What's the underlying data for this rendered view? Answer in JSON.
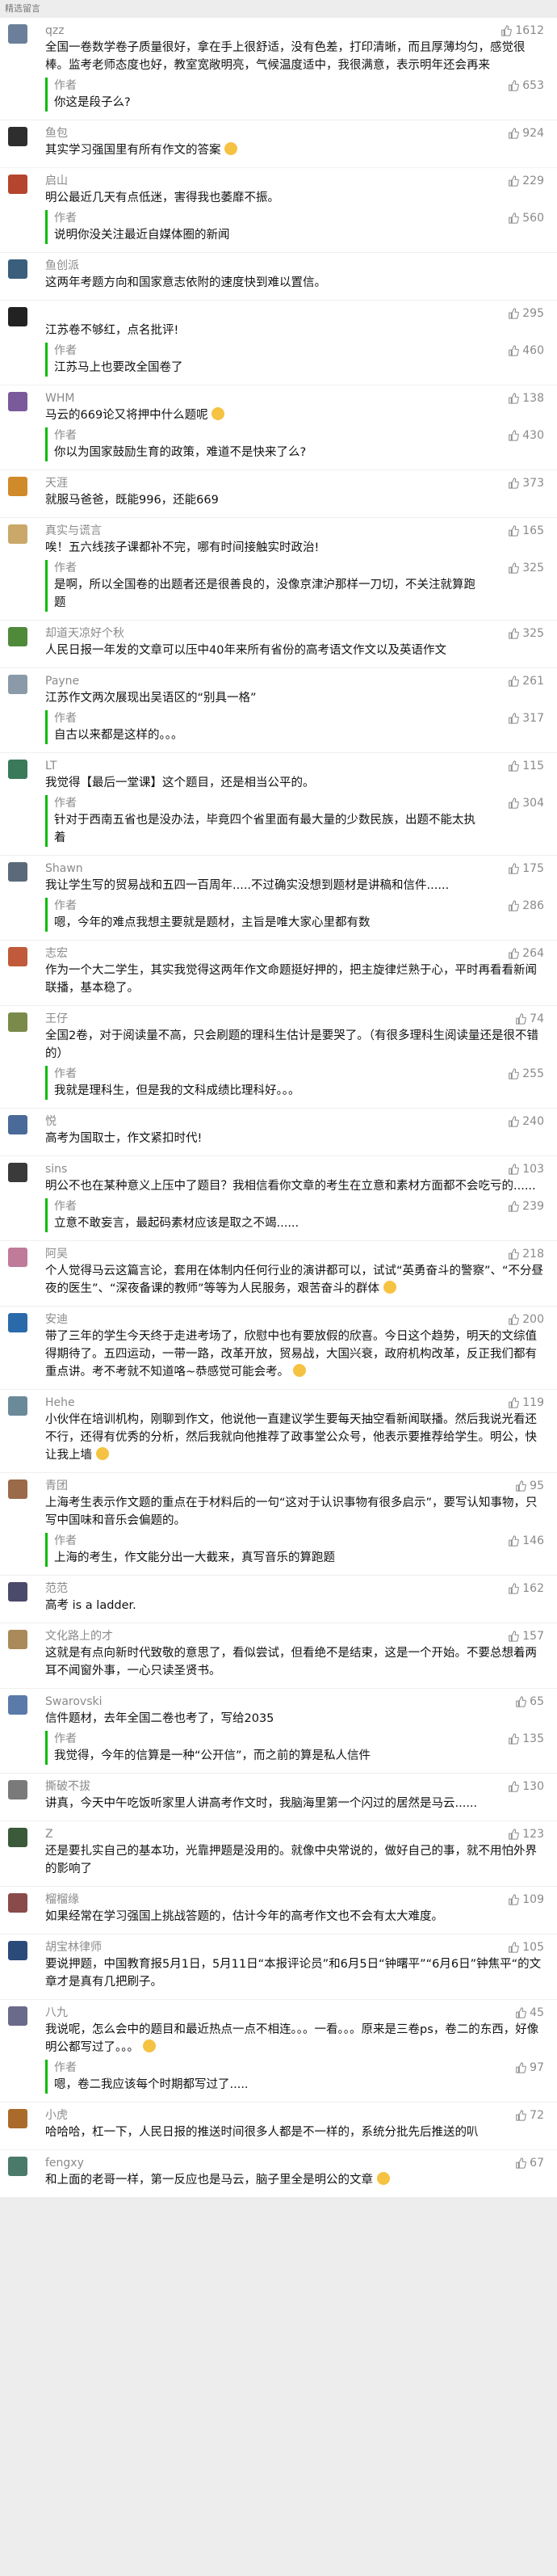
{
  "header": {
    "title": "精选留言"
  },
  "reply_author_label": "作者",
  "comments": [
    {
      "name": "qzz",
      "likes": "1612",
      "text": "全国一卷数学卷子质量很好，拿在手上很舒适，没有色差，打印清晰，而且厚薄均匀，感觉很棒。监考老师态度也好，教室宽敞明亮，气候温度适中，我很满意，表示明年还会再来",
      "reply": "你这是段子么?",
      "reply_likes": "653",
      "avatar_color": "#6b7f9a"
    },
    {
      "name": "鱼包",
      "likes": "924",
      "text": "其实学习强国里有所有作文的答案",
      "emoji": true,
      "avatar_color": "#2e2e2e"
    },
    {
      "name": "启山",
      "likes": "229",
      "text": "明公最近几天有点低迷，害得我也萎靡不振。",
      "reply": "说明你没关注最近自媒体圈的新闻",
      "reply_likes": "560",
      "avatar_color": "#b5452e"
    },
    {
      "name": "鱼创派",
      "likes": "",
      "text": "这两年考题方向和国家意志依附的速度快到难以置信。",
      "avatar_color": "#3a5f7d"
    },
    {
      "name": "",
      "likes": "295",
      "text": "江苏卷不够红，点名批评!",
      "reply": "江苏马上也要改全国卷了",
      "reply_likes": "460",
      "avatar_color": "#222222"
    },
    {
      "name": "WHM",
      "likes": "138",
      "text": "马云的669论又将押中什么题呢",
      "emoji": true,
      "reply": "你以为国家鼓励生育的政策，难道不是快来了么?",
      "reply_likes": "430",
      "avatar_color": "#7a5a9a"
    },
    {
      "name": "天涯",
      "likes": "373",
      "text": "就服马爸爸，既能996，还能669",
      "avatar_color": "#d08a2a"
    },
    {
      "name": "真实与谎言",
      "likes": "165",
      "text": "唉！五六线孩子课都补不完，哪有时间接触实时政治!",
      "reply": "是啊，所以全国卷的出题者还是很善良的，没像京津沪那样一刀切，不关注就算跑题",
      "reply_likes": "325",
      "avatar_color": "#c9a86a"
    },
    {
      "name": "却道天凉好个秋",
      "likes": "325",
      "text": "人民日报一年发的文章可以压中40年来所有省份的高考语文作文以及英语作文",
      "avatar_color": "#4f8a3a"
    },
    {
      "name": "Payne",
      "likes": "261",
      "text": "江苏作文两次展现出吴语区的“别具一格”",
      "reply": "自古以来都是这样的。。。",
      "reply_likes": "317",
      "avatar_color": "#8a9aa8"
    },
    {
      "name": "LT",
      "likes": "115",
      "text": "我觉得【最后一堂课】这个题目，还是相当公平的。",
      "reply": "针对于西南五省也是没办法，毕竟四个省里面有最大量的少数民族，出题不能太执着",
      "reply_likes": "304",
      "avatar_color": "#3a7a5a"
    },
    {
      "name": "Shawn",
      "likes": "175",
      "text": "我让学生写的贸易战和五四一百周年.....不过确实没想到题材是讲稿和信件......",
      "reply": "嗯，今年的难点我想主要就是题材，主旨是唯大家心里都有数",
      "reply_likes": "286",
      "avatar_color": "#5a6a7a"
    },
    {
      "name": "志宏",
      "likes": "264",
      "text": "作为一个大二学生，其实我觉得这两年作文命题挺好押的，把主旋律烂熟于心，平时再看看新闻联播，基本稳了。",
      "avatar_color": "#c05a3a"
    },
    {
      "name": "王仔",
      "likes": "74",
      "text": "全国2卷，对于阅读量不高，只会刷题的理科生估计是要哭了。（有很多理科生阅读量还是很不错的）",
      "reply": "我就是理科生，但是我的文科成绩比理科好。。。",
      "reply_likes": "255",
      "avatar_color": "#7a8a4a"
    },
    {
      "name": "悦",
      "likes": "240",
      "text": "高考为国取士，作文紧扣时代!",
      "avatar_color": "#4a6a9a"
    },
    {
      "name": "sins",
      "likes": "103",
      "text": "明公不也在某种意义上压中了题目？我相信看你文章的考生在立意和素材方面都不会吃亏的......",
      "reply": "立意不敢妄言，最起码素材应该是取之不竭......",
      "reply_likes": "239",
      "avatar_color": "#3a3a3a"
    },
    {
      "name": "阿吴",
      "likes": "218",
      "text": "个人觉得马云这篇言论，套用在体制内任何行业的演讲都可以，试试“英勇奋斗的警察”、“不分昼夜的医生”、“深夜备课的教师”等等为人民服务，艰苦奋斗的群体",
      "emoji": true,
      "avatar_color": "#c07a9a"
    },
    {
      "name": "安迪",
      "likes": "200",
      "text": "带了三年的学生今天终于走进考场了，欣慰中也有要放假的欣喜。今日这个趋势，明天的文综值得期待了。五四运动，一带一路，改革开放，贸易战，大国兴衰，政府机构改革，反正我们都有重点讲。考不考就不知道咯~恭感觉可能会考。",
      "emoji": true,
      "avatar_color": "#2a6aaa"
    },
    {
      "name": "Hehe",
      "likes": "119",
      "text": "小伙伴在培训机构，刚聊到作文，他说他一直建议学生要每天抽空看新闻联播。然后我说光看还不行，还得有优秀的分析，然后我就向他推荐了政事堂公众号，他表示要推荐给学生。明公，快让我上墙",
      "emoji": true,
      "avatar_color": "#6a8a9a"
    },
    {
      "name": "青团",
      "likes": "95",
      "text": "上海考生表示作文题的重点在于材料后的一句“这对于认识事物有很多启示”，要写认知事物，只写中国味和音乐会偏题的。",
      "reply": "上海的考生，作文能分出一大截来，真写音乐的算跑题",
      "reply_likes": "146",
      "avatar_color": "#9a6a4a"
    },
    {
      "name": "范范",
      "likes": "162",
      "text": "高考 is a ladder.",
      "avatar_color": "#4a4a6a"
    },
    {
      "name": "文化路上的才",
      "likes": "157",
      "text": "这就是有点向新时代致敬的意思了，看似尝试，但看绝不是结束，这是一个开始。不要总想着两耳不闻窗外事，一心只读圣贤书。",
      "avatar_color": "#aa8a5a"
    },
    {
      "name": "Swarovski",
      "likes": "65",
      "text": "信件题材，去年全国二卷也考了，写给2035",
      "reply": "我觉得，今年的信算是一种“公开信”，而之前的算是私人信件",
      "reply_likes": "135",
      "avatar_color": "#5a7aaa"
    },
    {
      "name": "撕破不拔",
      "likes": "130",
      "text": "讲真，今天中午吃饭听家里人讲高考作文时，我脑海里第一个闪过的居然是马云......",
      "avatar_color": "#7a7a7a"
    },
    {
      "name": "Z",
      "likes": "123",
      "text": "还是要扎实自己的基本功，光靠押题是没用的。就像中央常说的，做好自己的事，就不用怕外界的影响了",
      "avatar_color": "#3a5a3a"
    },
    {
      "name": "榴榴缘",
      "likes": "109",
      "text": "如果经常在学习强国上挑战答题的，估计今年的高考作文也不会有太大难度。",
      "avatar_color": "#8a4a4a"
    },
    {
      "name": "胡宝林律师",
      "likes": "105",
      "text": "要说押题，中国教育报5月1日，5月11日“本报评论员”和6月5日“钟曙平”“6月6日”钟焦平“的文章才是真有几把刷子。",
      "avatar_color": "#2a4a7a"
    },
    {
      "name": "八九",
      "likes": "45",
      "text": "我说呢，怎么会中的题目和最近热点一点不相连。。。一看。。。原来是三卷ps，卷二的东西，好像明公都写过了。。。",
      "emoji": true,
      "reply": "嗯，卷二我应该每个时期都写过了.....",
      "reply_likes": "97",
      "avatar_color": "#6a6a8a"
    },
    {
      "name": "小虎",
      "likes": "72",
      "text": "哈哈哈，杠一下，人民日报的推送时间很多人都是不一样的，系统分批先后推送的叭",
      "avatar_color": "#aa6a2a"
    },
    {
      "name": "fengxy",
      "likes": "67",
      "text": "和上面的老哥一样，第一反应也是马云，脑子里全是明公的文章",
      "emoji": true,
      "avatar_color": "#4a7a6a"
    }
  ]
}
